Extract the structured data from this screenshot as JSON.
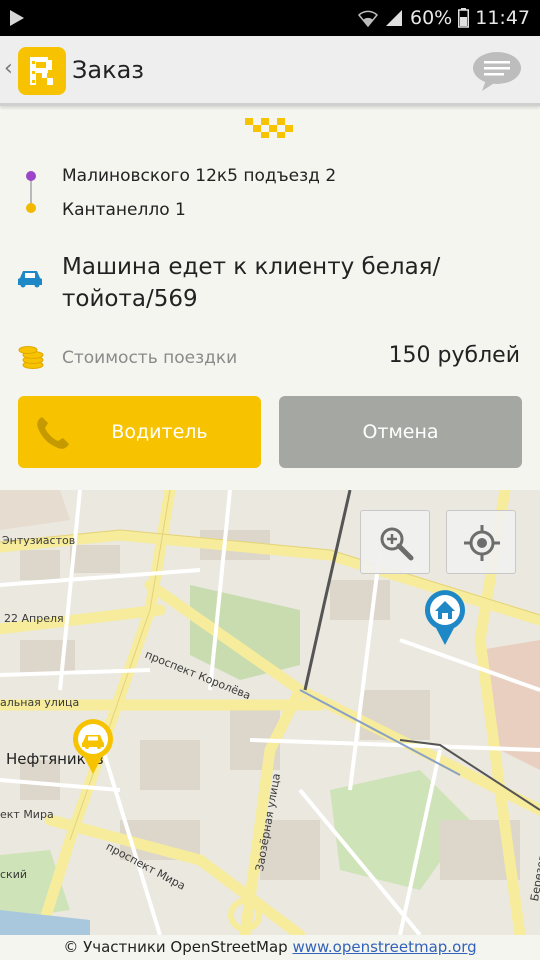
{
  "status_bar": {
    "battery": "60%",
    "time": "11:47"
  },
  "header": {
    "title": "Заказ"
  },
  "route": {
    "from": "Малиновского 12к5 подъезд 2",
    "to": "Кантанелло  1"
  },
  "order_status": "Машина едет к клиенту белая/ тойота/569",
  "cost": {
    "label": "Стоимость поездки",
    "value": "150 рублей"
  },
  "buttons": {
    "driver": "Водитель",
    "cancel": "Отмена"
  },
  "map": {
    "labels": {
      "enthusiasts": "Энтузиастов",
      "april22": "22 Апреля",
      "koroleva": "проспект Королёва",
      "neftyanikov": "Нефтяников",
      "mira": "проспект Мира",
      "mira_short": "ект Мира",
      "zavodskaya": "Заозёрная улица",
      "palnaya": "альная улица",
      "berezovskaya": "Березовск",
      "skiy": "ский"
    },
    "attribution_text": "© Участники OpenStreetMap",
    "attribution_link": "www.openstreetmap.org"
  },
  "colors": {
    "accent": "#f7c300",
    "cancel": "#a5a7a3",
    "pin": "#1e88c7"
  }
}
